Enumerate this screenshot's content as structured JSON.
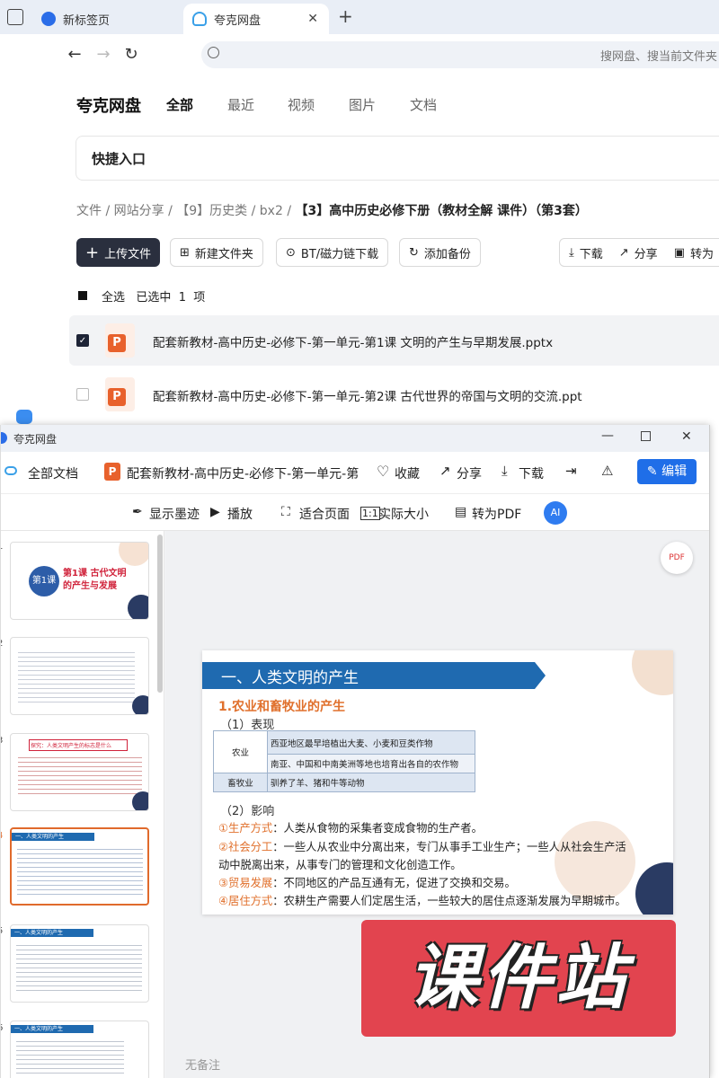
{
  "browser": {
    "tabs": [
      {
        "label": "新标签页",
        "active": false
      },
      {
        "label": "夸克网盘",
        "active": true
      }
    ],
    "new_tab": "+",
    "search_placeholder": "搜网盘、搜当前文件夹"
  },
  "drive": {
    "logo": "夸克网盘",
    "nav": [
      "全部",
      "最近",
      "视频",
      "图片",
      "文档"
    ],
    "quick_entry": "快捷入口",
    "breadcrumb": [
      "文件",
      "网站分享",
      "【9】历史类",
      "bx2",
      "【3】高中历史必修下册（教材全解 课件）（第3套）"
    ],
    "toolbar": {
      "upload": "上传文件",
      "new_folder": "新建文件夹",
      "bt": "BT/磁力链下载",
      "backup": "添加备份",
      "download": "下载",
      "share": "分享",
      "convert": "转为"
    },
    "select_all": "全选",
    "selected": "已选中",
    "selected_count": "1",
    "selected_unit": "项",
    "files": [
      {
        "name": "配套新教材-高中历史-必修下-第一单元-第1课 文明的产生与早期发展.pptx",
        "checked": true
      },
      {
        "name": "配套新教材-高中历史-必修下-第一单元-第2课 古代世界的帝国与文明的交流.ppt",
        "checked": false
      }
    ]
  },
  "viewer": {
    "window_title": "夸克网盘",
    "all_docs": "全部文档",
    "doc_title": "配套新教材-高中历史-必修下-第一单元-第",
    "favorite": "收藏",
    "share": "分享",
    "download": "下载",
    "edit": "编辑",
    "tools": [
      "显示墨迹",
      "播放",
      "适合页面",
      "实际大小",
      "转为PDF"
    ],
    "no_notes": "无备注",
    "thumbnails": [
      {
        "num": "1",
        "text": "第1课 古代文明的产生与发展"
      },
      {
        "num": "2",
        "text": ""
      },
      {
        "num": "3",
        "text": "探究：人类文明产生的标志是什么"
      },
      {
        "num": "4",
        "text": "一、人类文明的产生"
      },
      {
        "num": "5",
        "text": "一、人类文明的产生"
      },
      {
        "num": "6",
        "text": "一、人类文明的产生"
      }
    ],
    "slide": {
      "heading": "一、人类文明的产生",
      "subheading": "1.农业和畜牧业的产生",
      "label1": "（1）表现",
      "table": [
        {
          "category": "农业",
          "content": "西亚地区最早培植出大麦、小麦和豆类作物"
        },
        {
          "category": "",
          "content": "南亚、中国和中南美洲等地也培育出各自的农作物"
        },
        {
          "category": "畜牧业",
          "content": "驯养了羊、猪和牛等动物"
        }
      ],
      "label2": "（2）影响",
      "points": [
        {
          "key": "①生产方式",
          "text": "：人类从食物的采集者变成食物的生产者。"
        },
        {
          "key": "②社会分工",
          "text": "：一些人从农业中分离出来，专门从事手工业生产；一些人从社会生产活"
        },
        {
          "key": "",
          "text": "动中脱离出来，从事专门的管理和文化创造工作。"
        },
        {
          "key": "③贸易发展",
          "text": "：不同地区的产品互通有无，促进了交换和交易。"
        },
        {
          "key": "④居住方式",
          "text": "：农耕生产需要人们定居生活，一些较大的居住点逐渐发展为早期城市。"
        }
      ]
    }
  },
  "watermark": "课件站",
  "colors": {
    "accent": "#1f6ab0",
    "edit_button": "#1f6ee8",
    "highlight": "#e0702c"
  }
}
